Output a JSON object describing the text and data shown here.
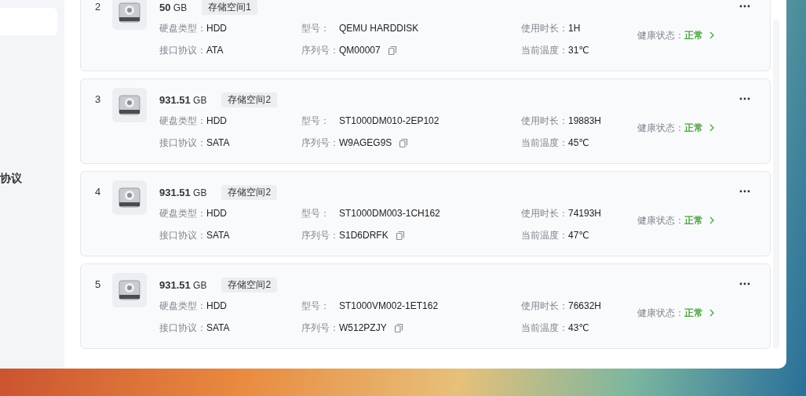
{
  "sidebar": {
    "items": [
      {
        "label": "协议"
      }
    ]
  },
  "disks": [
    {
      "index": "2",
      "size": "50",
      "unit": "GB",
      "pool": "存储空间1",
      "fields": [
        {
          "label": "硬盘类型：",
          "value": "HDD"
        },
        {
          "label": "型号：",
          "value": "QEMU HARDDISK"
        },
        {
          "label": "使用时长：",
          "value": "1H"
        },
        {
          "label": "接口协议：",
          "value": "ATA"
        },
        {
          "label": "序列号：",
          "value": "QM00007"
        },
        {
          "label": "当前温度：",
          "value": "31℃"
        }
      ],
      "health_label": "健康状态：",
      "health": "正常"
    },
    {
      "index": "3",
      "size": "931.51",
      "unit": "GB",
      "pool": "存储空间2",
      "fields": [
        {
          "label": "硬盘类型：",
          "value": "HDD"
        },
        {
          "label": "型号：",
          "value": "ST1000DM010-2EP102"
        },
        {
          "label": "使用时长：",
          "value": "19883H"
        },
        {
          "label": "接口协议：",
          "value": "SATA"
        },
        {
          "label": "序列号：",
          "value": "W9AGEG9S"
        },
        {
          "label": "当前温度：",
          "value": "45℃"
        }
      ],
      "health_label": "健康状态：",
      "health": "正常"
    },
    {
      "index": "4",
      "size": "931.51",
      "unit": "GB",
      "pool": "存储空间2",
      "fields": [
        {
          "label": "硬盘类型：",
          "value": "HDD"
        },
        {
          "label": "型号：",
          "value": "ST1000DM003-1CH162"
        },
        {
          "label": "使用时长：",
          "value": "74193H"
        },
        {
          "label": "接口协议：",
          "value": "SATA"
        },
        {
          "label": "序列号：",
          "value": "S1D6DRFK"
        },
        {
          "label": "当前温度：",
          "value": "47℃"
        }
      ],
      "health_label": "健康状态：",
      "health": "正常"
    },
    {
      "index": "5",
      "size": "931.51",
      "unit": "GB",
      "pool": "存储空间2",
      "fields": [
        {
          "label": "硬盘类型：",
          "value": "HDD"
        },
        {
          "label": "型号：",
          "value": "ST1000VM002-1ET162"
        },
        {
          "label": "使用时长：",
          "value": "76632H"
        },
        {
          "label": "接口协议：",
          "value": "SATA"
        },
        {
          "label": "序列号：",
          "value": "W512PZJY"
        },
        {
          "label": "当前温度：",
          "value": "43℃"
        }
      ],
      "health_label": "健康状态：",
      "health": "正常"
    }
  ]
}
